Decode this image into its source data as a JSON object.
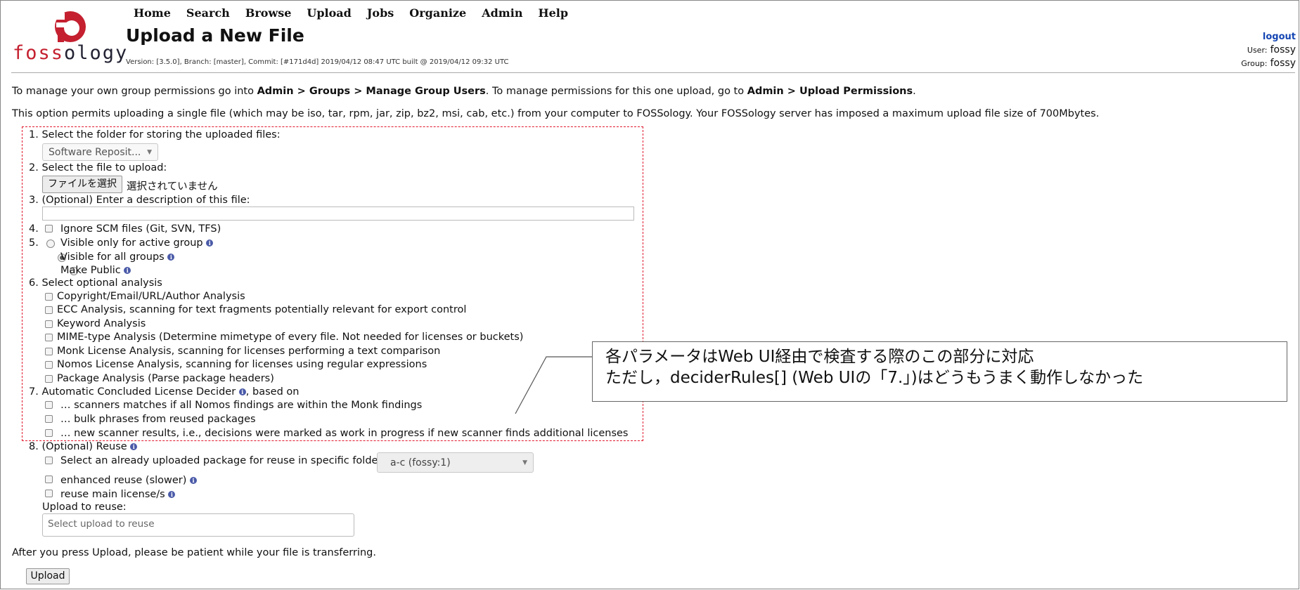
{
  "nav": [
    "Home",
    "Search",
    "Browse",
    "Upload",
    "Jobs",
    "Organize",
    "Admin",
    "Help"
  ],
  "logo_text": {
    "red": "foss",
    "dark": "ology"
  },
  "page_title": "Upload a New File",
  "version_text": "Version: [3.5.0], Branch: [master], Commit: [#171d4d] 2019/04/12 08:47 UTC built @ 2019/04/12 09:32 UTC",
  "account": {
    "logout": "logout",
    "user_label": "User:",
    "user": "fossy",
    "group_label": "Group:",
    "group": "fossy"
  },
  "intro": {
    "p1_a": "To manage your own group permissions go into ",
    "p1_b": "Admin > Groups > Manage Group Users",
    "p1_c": ". To manage permissions for this one upload, go to ",
    "p1_d": "Admin > Upload Permissions",
    "p1_e": ".",
    "p2": "This option permits uploading a single file (which may be iso, tar, rpm, jar, zip, bz2, msi, cab, etc.) from your computer to FOSSology. Your FOSSology server has imposed a maximum upload file size of 700Mbytes."
  },
  "form": {
    "s1": "1. Select the folder for storing the uploaded files:",
    "folder_value": "Software Reposit...",
    "s2": "2. Select the file to upload:",
    "file_button": "ファイルを選択",
    "file_none": "選択されていません",
    "s3": "3. (Optional) Enter a description of this file:",
    "s4_num": "4.",
    "s4": "Ignore SCM files (Git, SVN, TFS)",
    "s5_num": "5.",
    "vis_active": "Visible only for active group",
    "vis_all": "Visible for all groups",
    "vis_public": "Make Public",
    "s6": "6. Select optional analysis",
    "analysis": [
      "Copyright/Email/URL/Author Analysis",
      "ECC Analysis, scanning for text fragments potentially relevant for export control",
      "Keyword Analysis",
      "MIME-type Analysis (Determine mimetype of every file. Not needed for licenses or buckets)",
      "Monk License Analysis, scanning for licenses performing a text comparison",
      "Nomos License Analysis, scanning for licenses using regular expressions",
      "Package Analysis (Parse package headers)"
    ],
    "s7_a": "7. Automatic Concluded License Decider",
    "s7_b": ", based on",
    "decider": [
      "… scanners matches if all Nomos findings are within the Monk findings",
      "… bulk phrases from reused packages",
      "… new scanner results, i.e., decisions were marked as work in progress if new scanner finds additional licenses"
    ],
    "s8": "8. (Optional) Reuse",
    "reuse_folder_label": "Select an already uploaded package for reuse in specific folder",
    "reuse_folder_value": "a-c (fossy:1)",
    "enhanced": "enhanced reuse (slower)",
    "reuse_main": "reuse main license/s",
    "upload_to_reuse": "Upload to reuse:",
    "reuse_placeholder": "Select upload to reuse",
    "after": "After you press Upload, please be patient while your file is transferring.",
    "upload_button": "Upload"
  },
  "callout": {
    "line1": "各パラメータはWeb UI経由で検査する際のこの部分に対応",
    "line2": "ただし，deciderRules[] (Web UIの「7.」)はどうもうまく動作しなかった"
  },
  "colors": {
    "dash": "#e0182d",
    "logo_red": "#c4202f",
    "info": "#4a5aa8",
    "link": "#1546b3"
  }
}
